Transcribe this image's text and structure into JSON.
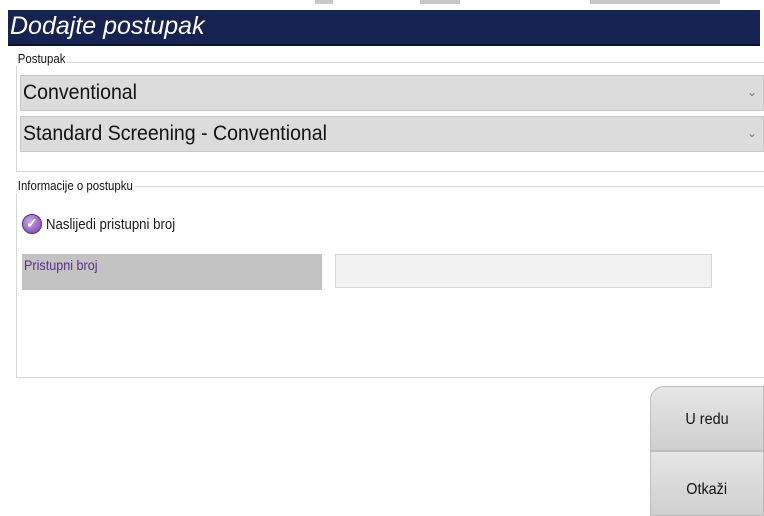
{
  "window": {
    "title": "Dodajte postupak"
  },
  "procedure_group": {
    "label": "Postupak",
    "procedure_select": "Conventional",
    "view_select": "Standard Screening - Conventional"
  },
  "info_group": {
    "label": "Informacije o postupku",
    "inherit_checkbox": {
      "label": "Naslijedi pristupni broj",
      "checked": true
    },
    "accession_label": "Pristupni broj",
    "accession_value": ""
  },
  "buttons": {
    "ok_label": "U redu",
    "cancel_label": "Otkaži"
  },
  "colors": {
    "titlebar": "#16224f",
    "accent_purple": "#9b6cc6"
  },
  "icons": {
    "dropdown": "chevron-down-icon",
    "checkbox": "check-circle-icon"
  }
}
